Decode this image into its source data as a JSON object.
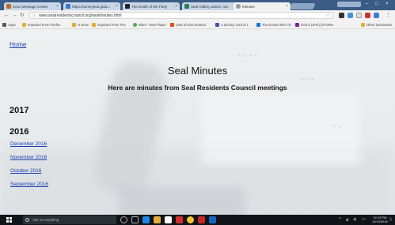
{
  "browser": {
    "tabs": [
      {
        "title": "Kunz Message Center",
        "color": "#c46a2a"
      },
      {
        "title": "https://surveyhub.gtdu.c",
        "color": "#3a78c9"
      },
      {
        "title": "The Death of the Party",
        "color": "#222222"
      },
      {
        "title": "Seal Gallery admin: ovs",
        "color": "#2e7d5a"
      },
      {
        "title": "Minutes",
        "color": "#9a9a9a"
      }
    ],
    "url": "www.sealresidentscouncil.org/sealminutes.html",
    "bookmarks": [
      {
        "label": "Apps",
        "color": "#5a5a5a"
      },
      {
        "label": "Imported From Firefox",
        "color": "#e2b035"
      },
      {
        "label": "G Drive",
        "color": "#e2b035"
      },
      {
        "label": "Imported From Fire",
        "color": "#e2b035"
      },
      {
        "label": "wkmt - New Player",
        "color": "#4caf50"
      },
      {
        "label": "Lists of Kiss Reuters",
        "color": "#e64a19"
      },
      {
        "label": "A dummy Lord of L",
        "color": "#3f51b5"
      },
      {
        "label": "The Doctor Who Tic",
        "color": "#1976d2"
      },
      {
        "label": "Find It (JPG) (OTOMA",
        "color": "#7b1fa2"
      },
      {
        "label": "Other bookmarks",
        "color": "#e2b035"
      }
    ]
  },
  "page": {
    "home_link": "Home",
    "title": "Seal Minutes",
    "subtitle": "Here are minutes from Seal Residents Council meetings",
    "year_2017": "2017",
    "year_2016": "2016",
    "months": [
      "December 2016",
      "November 2016",
      "October 2016",
      "September 2016"
    ]
  },
  "taskbar": {
    "search_placeholder": "Ask me anything",
    "time": "12:13 PM",
    "date": "11/10/2016"
  }
}
